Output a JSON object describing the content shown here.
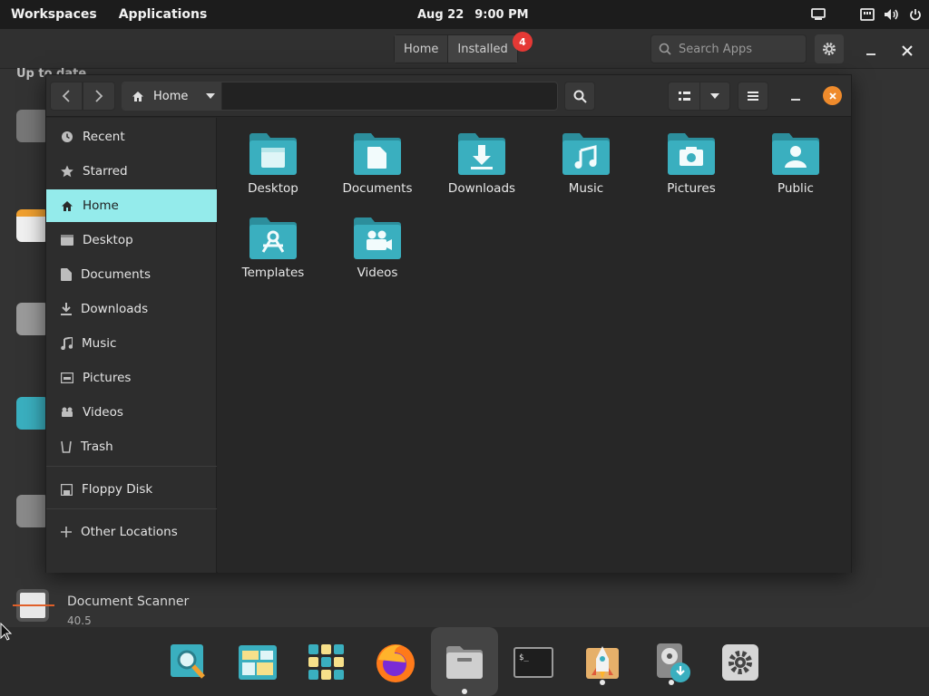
{
  "topbar": {
    "workspaces": "Workspaces",
    "applications": "Applications",
    "date": "Aug 22",
    "time": "9:00 PM"
  },
  "shop": {
    "tabs": [
      {
        "label": "Home"
      },
      {
        "label": "Installed"
      }
    ],
    "installed_badge": "4",
    "search_placeholder": "Search Apps",
    "section_title": "Up to date",
    "app_name": "Document Scanner",
    "app_version": "40.5"
  },
  "files": {
    "path": "Home",
    "sidebar": [
      {
        "label": "Recent",
        "icon": "clock-icon"
      },
      {
        "label": "Starred",
        "icon": "star-icon"
      },
      {
        "label": "Home",
        "icon": "home-icon"
      },
      {
        "label": "Desktop",
        "icon": "desktop-icon"
      },
      {
        "label": "Documents",
        "icon": "document-icon"
      },
      {
        "label": "Downloads",
        "icon": "download-icon"
      },
      {
        "label": "Music",
        "icon": "music-icon"
      },
      {
        "label": "Pictures",
        "icon": "picture-icon"
      },
      {
        "label": "Videos",
        "icon": "video-icon"
      },
      {
        "label": "Trash",
        "icon": "trash-icon"
      },
      {
        "label": "Floppy Disk",
        "icon": "floppy-icon"
      },
      {
        "label": "Other Locations",
        "icon": "plus-icon"
      }
    ],
    "items": [
      {
        "label": "Desktop",
        "icon": "desktop-folder-icon"
      },
      {
        "label": "Documents",
        "icon": "documents-folder-icon"
      },
      {
        "label": "Downloads",
        "icon": "downloads-folder-icon"
      },
      {
        "label": "Music",
        "icon": "music-folder-icon"
      },
      {
        "label": "Pictures",
        "icon": "pictures-folder-icon"
      },
      {
        "label": "Public",
        "icon": "public-folder-icon"
      },
      {
        "label": "Templates",
        "icon": "templates-folder-icon"
      },
      {
        "label": "Videos",
        "icon": "videos-folder-icon"
      }
    ]
  },
  "dock": [
    {
      "icon": "search-app-icon"
    },
    {
      "icon": "workspaces-icon"
    },
    {
      "icon": "app-grid-icon"
    },
    {
      "icon": "firefox-icon"
    },
    {
      "icon": "files-icon"
    },
    {
      "icon": "terminal-icon"
    },
    {
      "icon": "pop-shop-icon"
    },
    {
      "icon": "disk-installer-icon"
    },
    {
      "icon": "settings-icon"
    }
  ],
  "colors": {
    "accent": "#94ebeb",
    "folder": "#3aafbf",
    "close": "#ef8b2c",
    "badge": "#e53935"
  }
}
